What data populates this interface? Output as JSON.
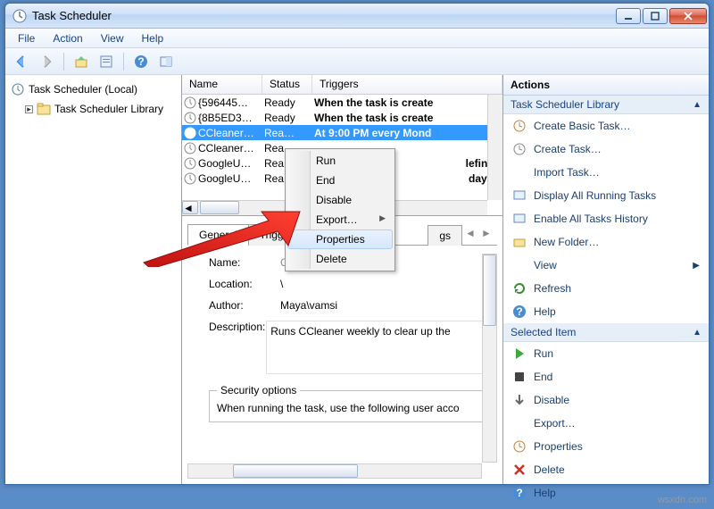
{
  "window": {
    "title": "Task Scheduler"
  },
  "menu": {
    "file": "File",
    "action": "Action",
    "view": "View",
    "help": "Help"
  },
  "tree": {
    "root": "Task Scheduler (Local)",
    "library": "Task Scheduler Library"
  },
  "list": {
    "columns": {
      "name": "Name",
      "status": "Status",
      "triggers": "Triggers"
    },
    "rows": [
      {
        "name": "{596445…",
        "status": "Ready",
        "trigger": "When the task is create"
      },
      {
        "name": "{8B5ED3…",
        "status": "Ready",
        "trigger": "When the task is create"
      },
      {
        "name": "CCleaner…",
        "status": "Rea…",
        "trigger": "At 9:00 PM every Mond"
      },
      {
        "name": "CCleaner…",
        "status": "Rea",
        "trigger": ""
      },
      {
        "name": "GoogleU…",
        "status": "Rea",
        "trigger": "lefine"
      },
      {
        "name": "GoogleU…",
        "status": "Rea",
        "trigger": "day -"
      }
    ]
  },
  "context_menu": {
    "run": "Run",
    "end": "End",
    "disable": "Disable",
    "export": "Export…",
    "properties": "Properties",
    "delete": "Delete"
  },
  "tabs": {
    "general": "General",
    "triggers": "Triggers",
    "trailing": "gs"
  },
  "details": {
    "name_label": "Name:",
    "name_value": "CCleaner Weekly Run",
    "location_label": "Location:",
    "location_value": "\\",
    "author_label": "Author:",
    "author_value": "Maya\\vamsi",
    "description_label": "Description:",
    "description_value": "Runs CCleaner weekly to clear up the",
    "security_header": "Security options",
    "security_text": "When running the task, use the following user acco"
  },
  "actions": {
    "header": "Actions",
    "group1": "Task Scheduler Library",
    "create_basic": "Create Basic Task…",
    "create_task": "Create Task…",
    "import_task": "Import Task…",
    "display_running": "Display All Running Tasks",
    "enable_history": "Enable All Tasks History",
    "new_folder": "New Folder…",
    "view": "View",
    "refresh": "Refresh",
    "help": "Help",
    "group2": "Selected Item",
    "run": "Run",
    "end": "End",
    "disable": "Disable",
    "export": "Export…",
    "properties": "Properties",
    "delete": "Delete",
    "help2": "Help"
  },
  "watermark": "wsxdn.com"
}
